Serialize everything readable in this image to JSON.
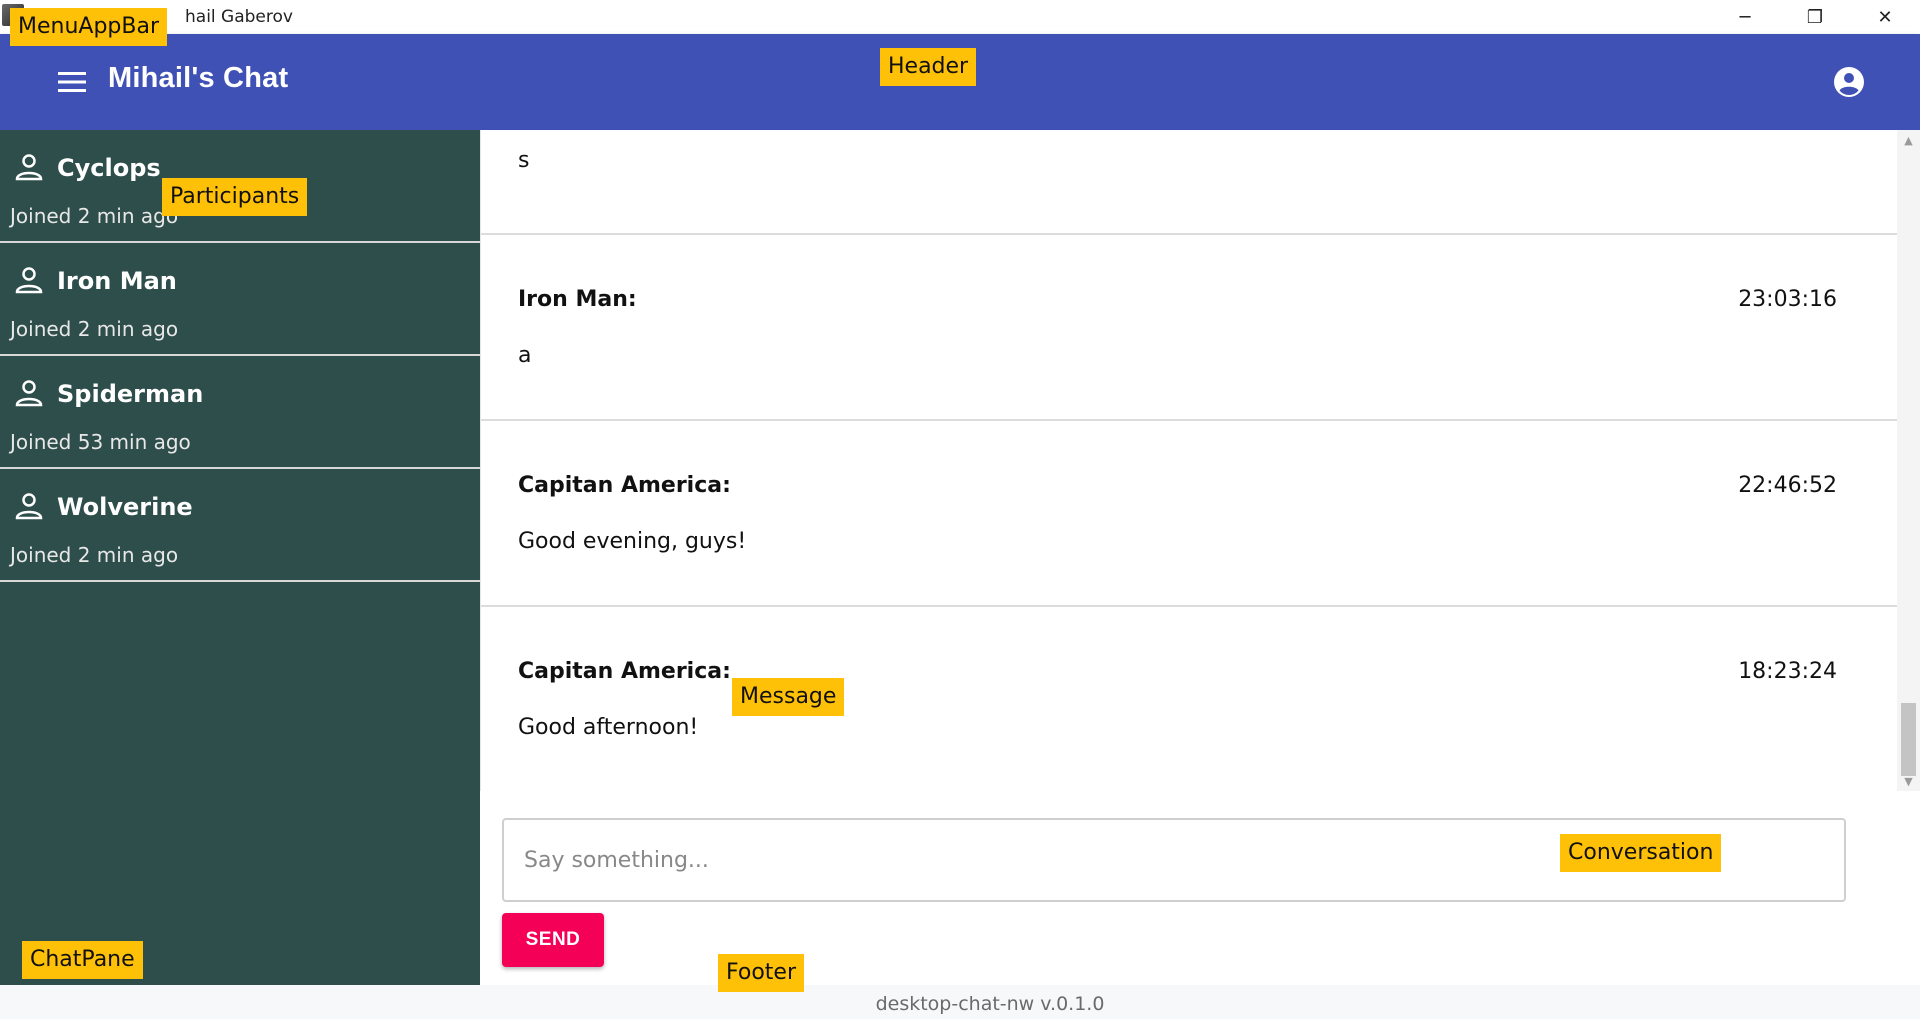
{
  "window": {
    "title": "hail Gaberov",
    "minimize": "─",
    "maximize": "❐",
    "close": "✕"
  },
  "header": {
    "app_title": "Mihail's Chat"
  },
  "participants": [
    {
      "name": "Cyclops",
      "joined": "Joined 2 min ago"
    },
    {
      "name": "Iron Man",
      "joined": "Joined 2 min ago"
    },
    {
      "name": "Spiderman",
      "joined": "Joined 53 min ago"
    },
    {
      "name": "Wolverine",
      "joined": "Joined 2 min ago"
    }
  ],
  "messages": [
    {
      "author": "",
      "time": "",
      "text": "s"
    },
    {
      "author": "Iron Man:",
      "time": "23:03:16",
      "text": "a"
    },
    {
      "author": "Capitan America:",
      "time": "22:46:52",
      "text": "Good evening, guys!"
    },
    {
      "author": "Capitan America:",
      "time": "18:23:24",
      "text": "Good afternoon!"
    }
  ],
  "composer": {
    "placeholder": "Say something...",
    "send_label": "SEND"
  },
  "footer": {
    "version": "desktop-chat-nw v.0.1.0"
  },
  "annotations": {
    "menu_app_bar": "MenuAppBar",
    "header": "Header",
    "participants": "Participants",
    "message": "Message",
    "conversation": "Conversation",
    "chat_pane": "ChatPane",
    "footer": "Footer"
  },
  "colors": {
    "header_bg": "#3f51b5",
    "chatpane_bg": "#2e4e4b",
    "send_button": "#f50057",
    "annotation": "#ffc107"
  }
}
